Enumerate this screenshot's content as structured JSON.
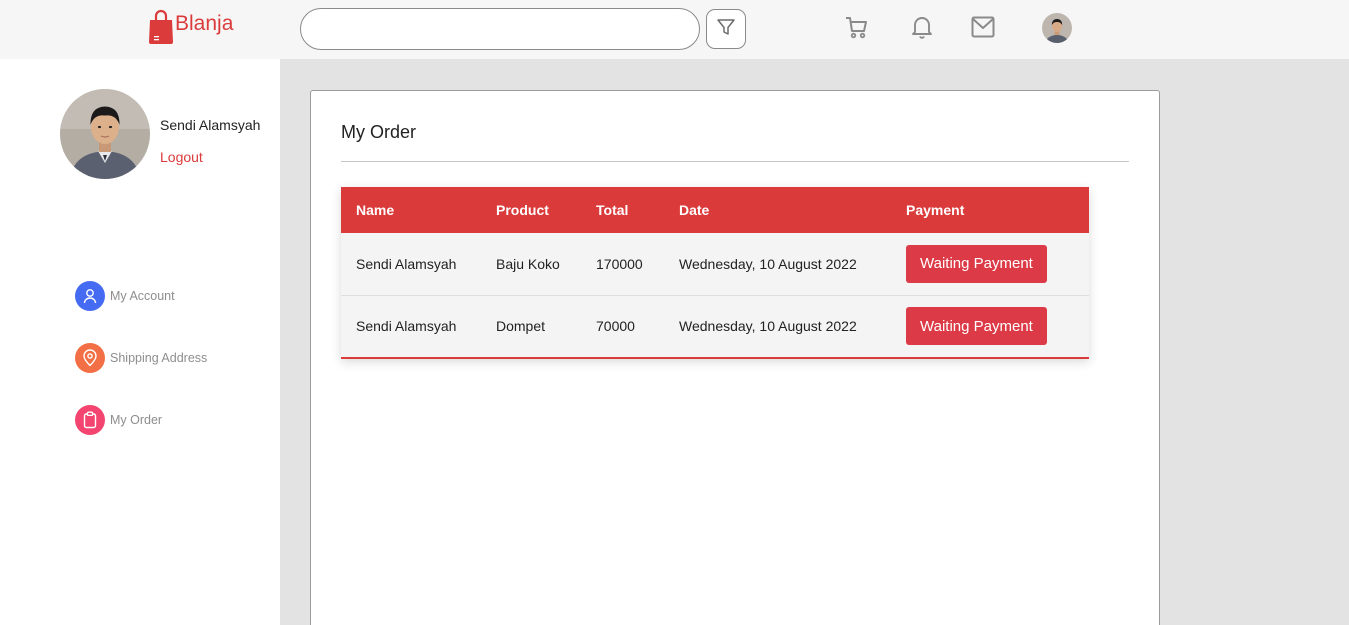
{
  "brand": {
    "name": "Blanja",
    "color": "#db3b3b"
  },
  "header": {
    "search_placeholder": "",
    "icons": [
      "filter-icon",
      "cart-icon",
      "bell-icon",
      "mail-icon",
      "avatar"
    ]
  },
  "profile": {
    "name": "Sendi Alamsyah",
    "logout_label": "Logout"
  },
  "sidebar": {
    "items": [
      {
        "label": "My Account",
        "icon": "user-icon",
        "color": "#456bf3"
      },
      {
        "label": "Shipping Address",
        "icon": "map-pin-icon",
        "color": "#f36f45"
      },
      {
        "label": "My Order",
        "icon": "clipboard-icon",
        "color": "#f3456f"
      }
    ]
  },
  "main": {
    "title": "My Order",
    "table": {
      "columns": [
        "Name",
        "Product",
        "Total",
        "Date",
        "Payment"
      ],
      "rows": [
        {
          "name": "Sendi Alamsyah",
          "product": "Baju Koko",
          "total": "170000",
          "date": "Wednesday, 10 August 2022",
          "payment": "Waiting Payment"
        },
        {
          "name": "Sendi Alamsyah",
          "product": "Dompet",
          "total": "70000",
          "date": "Wednesday, 10 August 2022",
          "payment": "Waiting Payment"
        }
      ]
    }
  },
  "colors": {
    "accent": "#db3b3b",
    "header_bg": "#f6f6f7",
    "content_bg": "#e3e3e3"
  }
}
